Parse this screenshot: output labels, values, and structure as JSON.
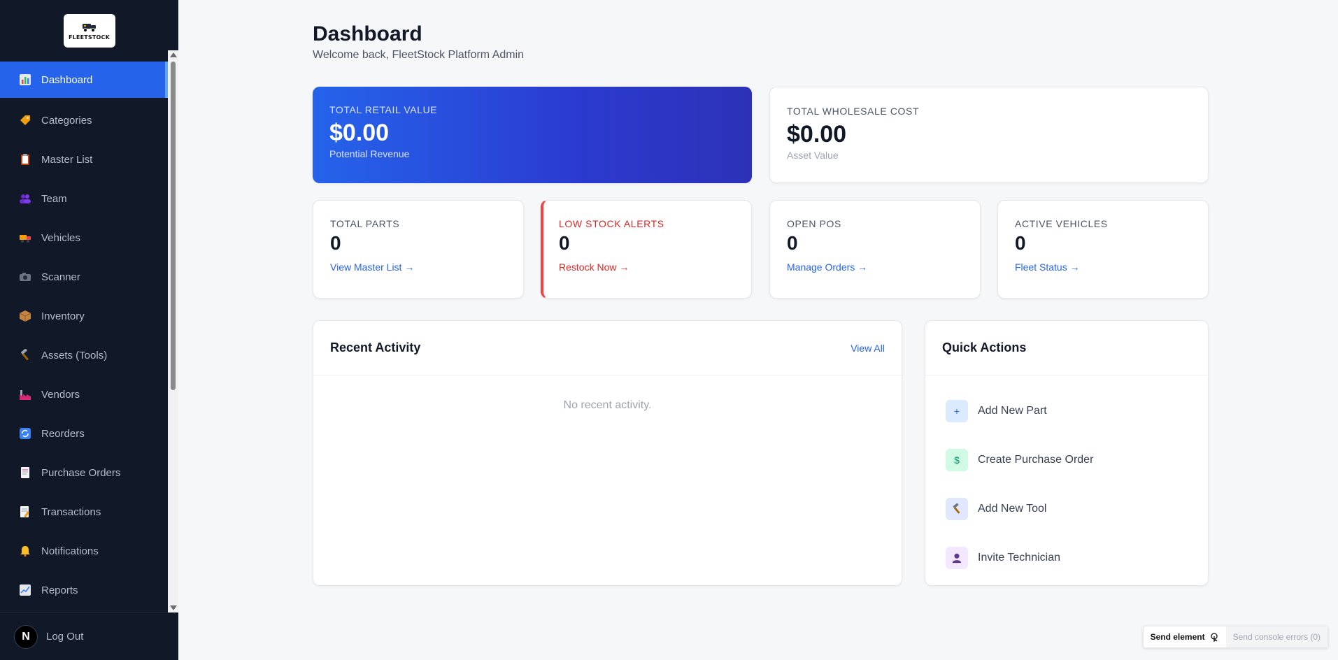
{
  "brand": {
    "logo_text": "FLEETSTOCK"
  },
  "sidebar": {
    "items": [
      {
        "label": "Dashboard",
        "icon": "bar-chart-icon",
        "active": true
      },
      {
        "label": "Categories",
        "icon": "tag-icon"
      },
      {
        "label": "Master List",
        "icon": "clipboard-icon"
      },
      {
        "label": "Team",
        "icon": "people-icon"
      },
      {
        "label": "Vehicles",
        "icon": "truck-icon"
      },
      {
        "label": "Scanner",
        "icon": "camera-icon"
      },
      {
        "label": "Inventory",
        "icon": "package-icon"
      },
      {
        "label": "Assets (Tools)",
        "icon": "hammer-icon"
      },
      {
        "label": "Vendors",
        "icon": "factory-icon"
      },
      {
        "label": "Reorders",
        "icon": "refresh-icon"
      },
      {
        "label": "Purchase Orders",
        "icon": "document-icon"
      },
      {
        "label": "Transactions",
        "icon": "memo-icon"
      },
      {
        "label": "Notifications",
        "icon": "bell-icon"
      },
      {
        "label": "Reports",
        "icon": "line-chart-icon"
      }
    ],
    "logout": {
      "avatar_letter": "N",
      "label": "Log Out"
    }
  },
  "header": {
    "title": "Dashboard",
    "subtitle": "Welcome back, FleetStock Platform Admin"
  },
  "summary": {
    "retail": {
      "label": "TOTAL RETAIL VALUE",
      "value": "$0.00",
      "caption": "Potential Revenue"
    },
    "wholesale": {
      "label": "TOTAL WHOLESALE COST",
      "value": "$0.00",
      "caption": "Asset Value"
    }
  },
  "stats": {
    "parts": {
      "label": "TOTAL PARTS",
      "value": "0",
      "link": "View Master List →"
    },
    "low_stock": {
      "label": "LOW STOCK ALERTS",
      "value": "0",
      "link": "Restock Now →"
    },
    "open_pos": {
      "label": "OPEN POS",
      "value": "0",
      "link": "Manage Orders →"
    },
    "vehicles": {
      "label": "ACTIVE VEHICLES",
      "value": "0",
      "link": "Fleet Status →"
    }
  },
  "activity": {
    "title": "Recent Activity",
    "view_all": "View All",
    "empty": "No recent activity."
  },
  "quick_actions": {
    "title": "Quick Actions",
    "items": [
      {
        "label": "Add New Part",
        "icon": "plus-icon",
        "glyph": "+"
      },
      {
        "label": "Create Purchase Order",
        "icon": "dollar-icon",
        "glyph": "$"
      },
      {
        "label": "Add New Tool",
        "icon": "hammer-icon",
        "glyph": "🔨"
      },
      {
        "label": "Invite Technician",
        "icon": "person-icon",
        "glyph": "👤"
      }
    ]
  },
  "devbar": {
    "send_element": "Send element",
    "send_errors": "Send console errors (0)"
  },
  "colors": {
    "sidebar_bg": "#111827",
    "accent": "#2563eb",
    "danger": "#dc2626"
  }
}
